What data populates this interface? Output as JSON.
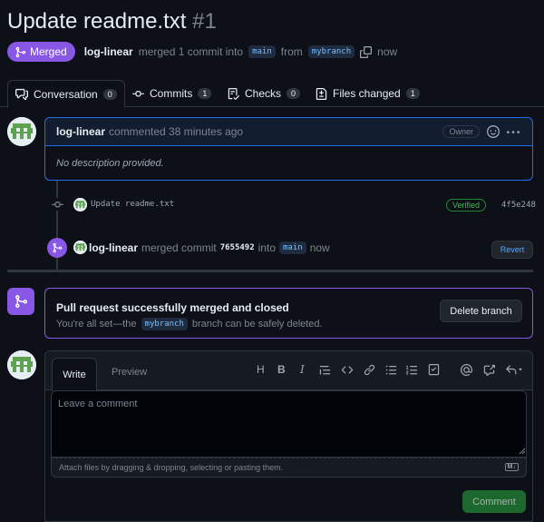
{
  "header": {
    "title": "Update readme.txt",
    "number": "#1",
    "status": "Merged",
    "author": "log-linear",
    "summary": "merged 1 commit into",
    "base_branch": "main",
    "from_word": "from",
    "head_branch": "mybranch",
    "time": "now"
  },
  "tabs": [
    {
      "label": "Conversation",
      "count": "0",
      "icon": "comment-discussion-icon"
    },
    {
      "label": "Commits",
      "count": "1",
      "icon": "commit-icon"
    },
    {
      "label": "Checks",
      "count": "0",
      "icon": "checklist-icon"
    },
    {
      "label": "Files changed",
      "count": "1",
      "icon": "file-diff-icon"
    }
  ],
  "comment": {
    "author": "log-linear",
    "action": "commented 38 minutes ago",
    "role": "Owner",
    "body": "No description provided."
  },
  "commit": {
    "message": "Update readme.txt",
    "verified": "Verified",
    "sha": "4f5e248"
  },
  "merge_event": {
    "author": "log-linear",
    "action": "merged commit",
    "sha": "7655492",
    "into": "into",
    "branch": "main",
    "time": "now",
    "revert_label": "Revert"
  },
  "merged_box": {
    "title": "Pull request successfully merged and closed",
    "text_before": "You're all set—the",
    "branch": "mybranch",
    "text_after": "branch can be safely deleted.",
    "delete_label": "Delete branch"
  },
  "editor": {
    "write_tab": "Write",
    "preview_tab": "Preview",
    "placeholder": "Leave a comment",
    "attach_text": "Attach files by dragging & dropping, selecting or pasting them.",
    "markdown_badge": "M↓",
    "submit_label": "Comment",
    "tools": [
      "H",
      "B",
      "I"
    ]
  },
  "colors": {
    "merged": "#8957e5",
    "accent_blue": "#1f6feb",
    "success": "#238636",
    "background": "#0d1117"
  }
}
